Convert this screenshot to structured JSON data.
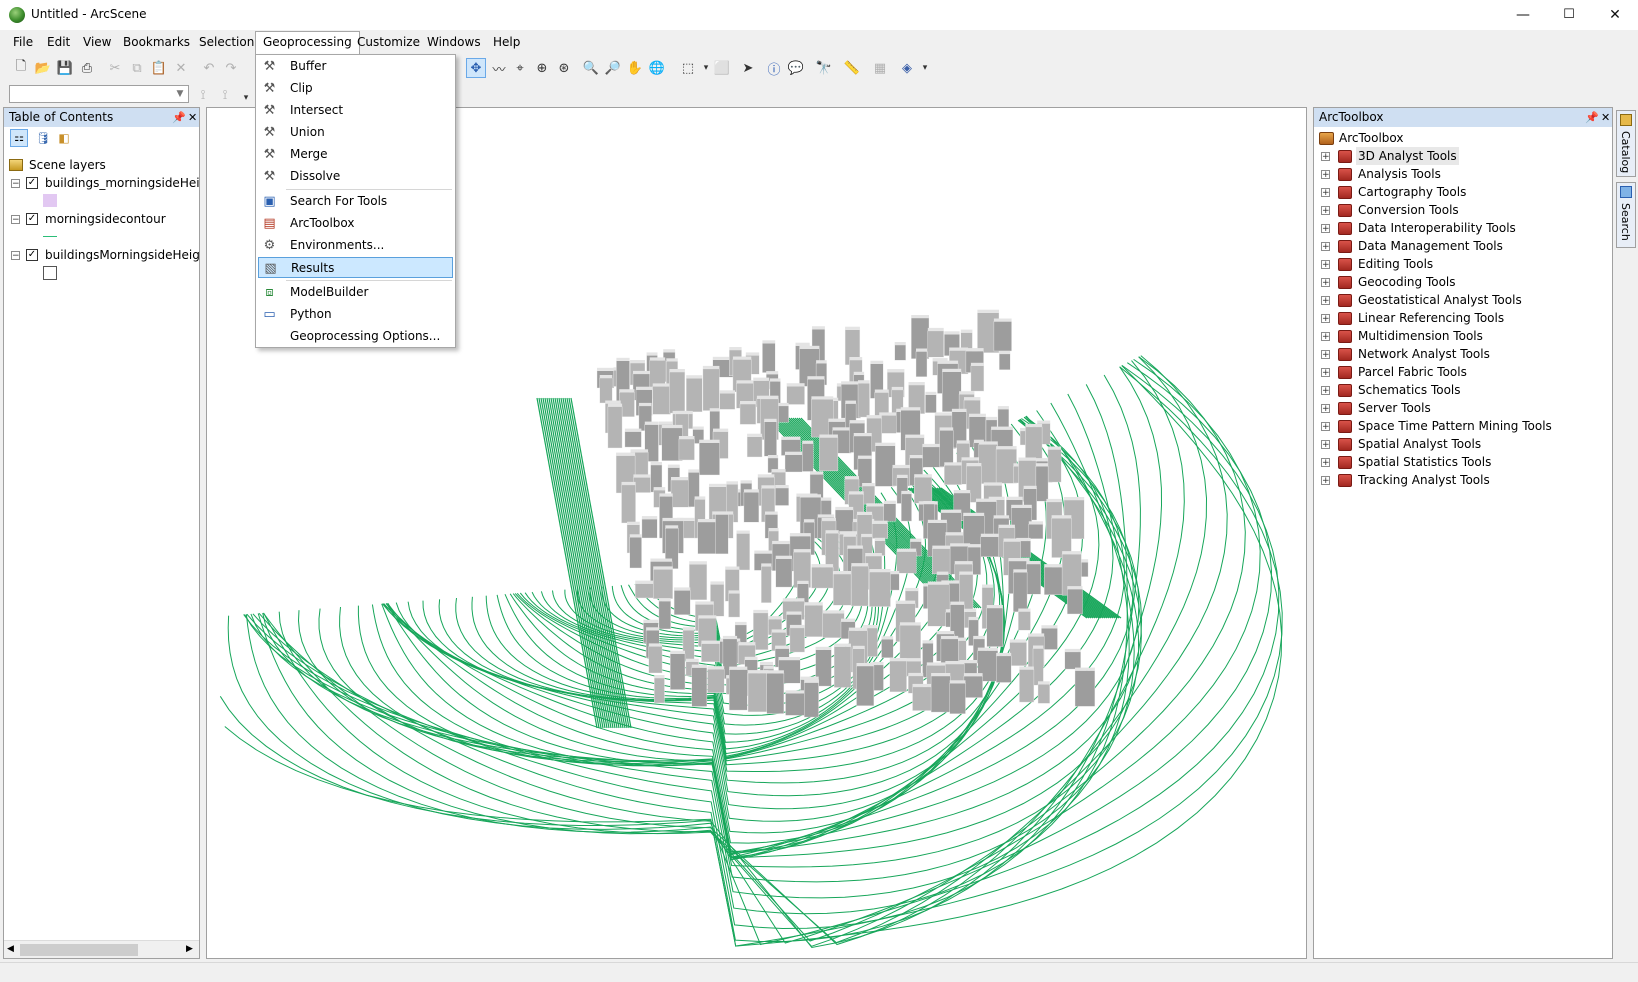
{
  "window": {
    "title": "Untitled - ArcScene",
    "minimize": "—",
    "maximize": "☐",
    "close": "✕"
  },
  "menubar": {
    "items": [
      "File",
      "Edit",
      "View",
      "Bookmarks",
      "Selection",
      "Geoprocessing",
      "Customize",
      "Windows",
      "Help"
    ],
    "active": "Geoprocessing"
  },
  "geoprocessing_menu": {
    "items": [
      {
        "label": "Buffer",
        "icon": "hammer-icon"
      },
      {
        "label": "Clip",
        "icon": "hammer-icon"
      },
      {
        "label": "Intersect",
        "icon": "hammer-icon"
      },
      {
        "label": "Union",
        "icon": "hammer-icon"
      },
      {
        "label": "Merge",
        "icon": "hammer-icon"
      },
      {
        "label": "Dissolve",
        "icon": "hammer-icon"
      },
      {
        "label": "Search For Tools",
        "icon": "search-window-icon"
      },
      {
        "label": "ArcToolbox",
        "icon": "toolbox-icon"
      },
      {
        "label": "Environments...",
        "icon": "tools-icon"
      },
      {
        "label": "Results",
        "icon": "results-icon",
        "highlighted": true
      },
      {
        "label": "ModelBuilder",
        "icon": "model-icon"
      },
      {
        "label": "Python",
        "icon": "python-window-icon"
      },
      {
        "label": "Geoprocessing Options...",
        "icon": ""
      }
    ]
  },
  "toc": {
    "title": "Table of Contents",
    "root": "Scene layers",
    "layers": [
      {
        "name": "buildings_morningsideHeigh",
        "checked": true,
        "swatch": "#e2c8f2"
      },
      {
        "name": "morningsidecontour",
        "checked": true,
        "swatch": "#2bbd78"
      },
      {
        "name": "buildingsMorningsideHeight",
        "checked": true,
        "swatch": "#ffffff"
      }
    ]
  },
  "arctoolbox": {
    "title": "ArcToolbox",
    "root": "ArcToolbox",
    "tools": [
      "3D Analyst Tools",
      "Analysis Tools",
      "Cartography Tools",
      "Conversion Tools",
      "Data Interoperability Tools",
      "Data Management Tools",
      "Editing Tools",
      "Geocoding Tools",
      "Geostatistical Analyst Tools",
      "Linear Referencing Tools",
      "Multidimension Tools",
      "Network Analyst Tools",
      "Parcel Fabric Tools",
      "Schematics Tools",
      "Server Tools",
      "Space Time Pattern Mining Tools",
      "Spatial Analyst Tools",
      "Spatial Statistics Tools",
      "Tracking Analyst Tools"
    ],
    "selected": "3D Analyst Tools"
  },
  "side_tabs": [
    "Catalog",
    "Search"
  ],
  "colors": {
    "contour": "#17a65a",
    "building": "#a9a9a9",
    "highlight": "#cce8ff"
  }
}
